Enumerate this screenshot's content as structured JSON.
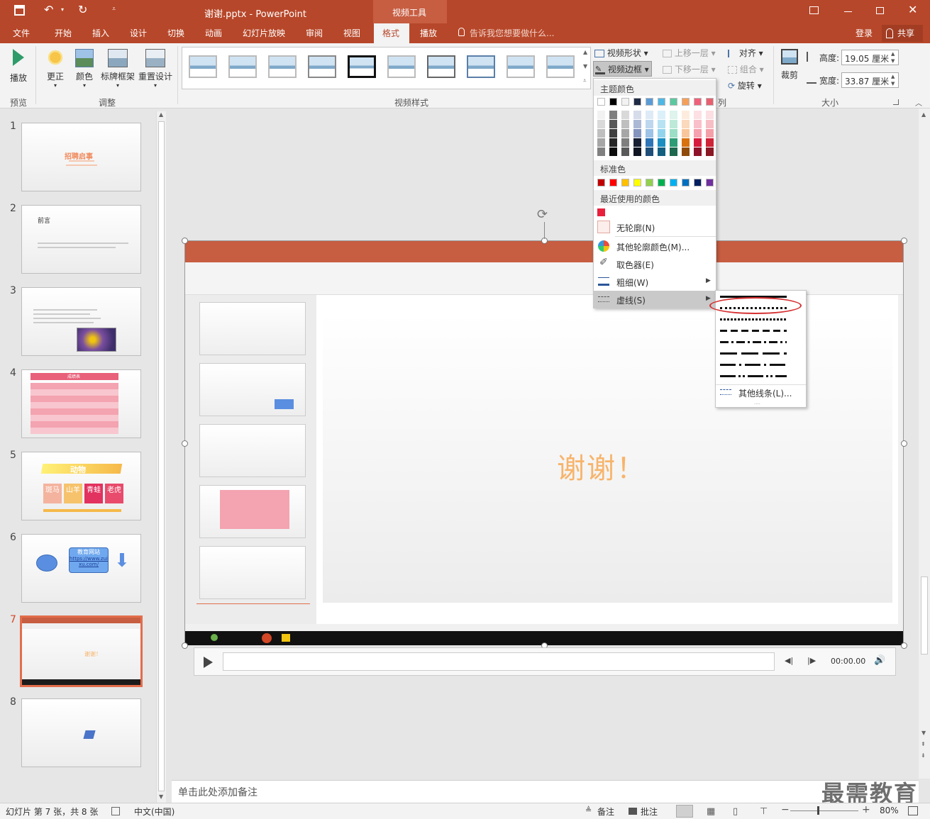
{
  "titlebar": {
    "title": "谢谢.pptx - PowerPoint",
    "context_tab": "视频工具"
  },
  "tabs": [
    "文件",
    "开始",
    "插入",
    "设计",
    "切换",
    "动画",
    "幻灯片放映",
    "审阅",
    "视图",
    "格式",
    "播放"
  ],
  "tellme": "告诉我您想要做什么...",
  "login": "登录",
  "share": "共享",
  "ribbon": {
    "play": "播放",
    "correct": "更正",
    "color": "颜色",
    "poster": "标牌框架",
    "reset": "重置设计",
    "group_preview": "预览",
    "group_adjust": "调整",
    "group_styles": "视频样式",
    "group_size": "大小",
    "video_shape": "视频形状",
    "video_border": "视频边框",
    "video_effects": "列",
    "bring_forward": "上移一层",
    "send_backward": "下移一层",
    "align": "对齐",
    "group": "组合",
    "rotate": "旋转",
    "crop": "裁剪",
    "height_label": "高度:",
    "height_value": "19.05 厘米",
    "width_label": "宽度:",
    "width_value": "33.87 厘米"
  },
  "slides": [
    {
      "num": "1",
      "title": "招聘启事"
    },
    {
      "num": "2",
      "title": "前言"
    },
    {
      "num": "3",
      "title": ""
    },
    {
      "num": "4",
      "title": "成绩表"
    },
    {
      "num": "5",
      "title": "动物",
      "cells": [
        "斑马",
        "山羊",
        "青蛙",
        "老虎"
      ]
    },
    {
      "num": "6",
      "title": "教育网站",
      "link": "https://www.zuixu.com/"
    },
    {
      "num": "7",
      "title": "谢谢！"
    },
    {
      "num": "8",
      "title": ""
    }
  ],
  "main_slide": {
    "text": "谢谢！",
    "player_time": "00:00.00"
  },
  "menu": {
    "theme_colors": "主题颜色",
    "standard_colors": "标准色",
    "recent_colors": "最近使用的颜色",
    "no_outline": "无轮廓(N)",
    "more_colors": "其他轮廓颜色(M)...",
    "eyedropper": "取色器(E)",
    "weight": "粗细(W)",
    "dashes": "虚线(S)"
  },
  "submenu": {
    "more_lines": "其他线条(L)..."
  },
  "notes": "单击此处添加备注",
  "status": {
    "slide_info": "幻灯片 第 7 张，共 8 张",
    "language": "中文(中国)",
    "notes_btn": "备注",
    "comments_btn": "批注",
    "zoom": "80%"
  },
  "watermark": "最需教育",
  "colors": {
    "accent": "#b7472a",
    "selected_tab_text": "#b7472a",
    "highlight": "#c9c9c9"
  }
}
